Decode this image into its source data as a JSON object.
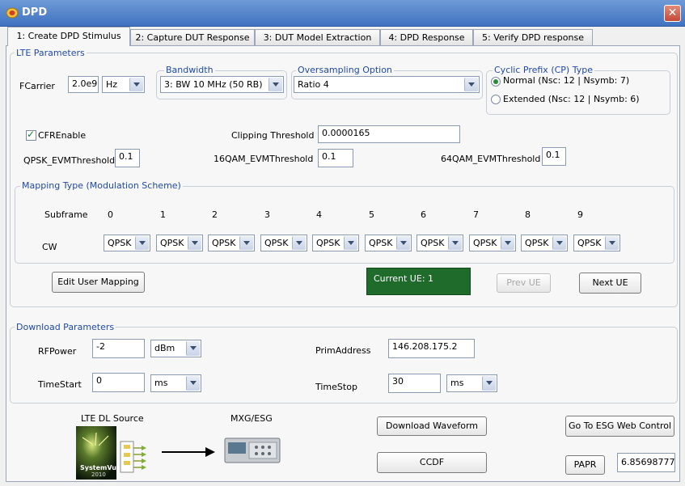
{
  "window": {
    "title": "DPD",
    "close_glyph": "✕"
  },
  "tabs": [
    {
      "label": "1: Create DPD Stimulus",
      "active": true
    },
    {
      "label": "2: Capture DUT Response",
      "active": false
    },
    {
      "label": "3: DUT Model Extraction",
      "active": false
    },
    {
      "label": "4: DPD Response",
      "active": false
    },
    {
      "label": "5: Verify DPD response",
      "active": false
    }
  ],
  "lte": {
    "group_title": "LTE Parameters",
    "fcarrier_label": "FCarrier",
    "fcarrier_value": "2.0e9",
    "fcarrier_unit": "Hz",
    "bandwidth_title": "Bandwidth",
    "bandwidth_value": "3: BW 10 MHz (50 RB)",
    "oversampling_title": "Oversampling Option",
    "oversampling_value": "Ratio 4",
    "cp_title": "Cyclic Prefix (CP) Type",
    "cp_normal": "Normal (Nsc: 12 | Nsymb: 7)",
    "cp_extended": "Extended (Nsc: 12 | Nsymb: 6)",
    "cp_selected": "normal",
    "cfr_label": "CFREnable",
    "cfr_checked": true,
    "clipping_label": "Clipping Threshold",
    "clipping_value": "0.0000165",
    "qpsk_label": "QPSK_EVMThreshold",
    "qpsk_value": "0.1",
    "qam16_label": "16QAM_EVMThreshold",
    "qam16_value": "0.1",
    "qam64_label": "64QAM_EVMThreshold",
    "qam64_value": "0.1"
  },
  "mapping": {
    "group_title": "Mapping Type (Modulation Scheme)",
    "subframe_label": "Subframe",
    "cw_label": "CW",
    "subframes": [
      "0",
      "1",
      "2",
      "3",
      "4",
      "5",
      "6",
      "7",
      "8",
      "9"
    ],
    "cw_values": [
      "QPSK",
      "QPSK",
      "QPSK",
      "QPSK",
      "QPSK",
      "QPSK",
      "QPSK",
      "QPSK",
      "QPSK",
      "QPSK"
    ]
  },
  "ue": {
    "edit_mapping_label": "Edit User Mapping",
    "current_ue": "Current UE: 1",
    "prev_label": "Prev UE",
    "next_label": "Next UE"
  },
  "download": {
    "group_title": "Download Parameters",
    "rfpower_label": "RFPower",
    "rfpower_value": "-2",
    "rfpower_unit": "dBm",
    "timestart_label": "TimeStart",
    "timestart_value": "0",
    "timestart_unit": "ms",
    "primaddress_label": "PrimAddress",
    "primaddress_value": "146.208.175.2",
    "timestop_label": "TimeStop",
    "timestop_value": "30",
    "timestop_unit": "ms"
  },
  "bottom": {
    "source_label": "LTE DL Source",
    "dest_label": "MXG/ESG",
    "logo_text": "SystemVue",
    "logo_year": "2010",
    "download_waveform_label": "Download Waveform",
    "ccdf_label": "CCDF",
    "esg_web_label": "Go To ESG Web Control",
    "papr_label": "PAPR",
    "papr_value": "6.85698777"
  },
  "colors": {
    "accent": "#1f4aa8",
    "title_bar": "#4a7cc8",
    "ue_green": "#1f6b2c"
  }
}
